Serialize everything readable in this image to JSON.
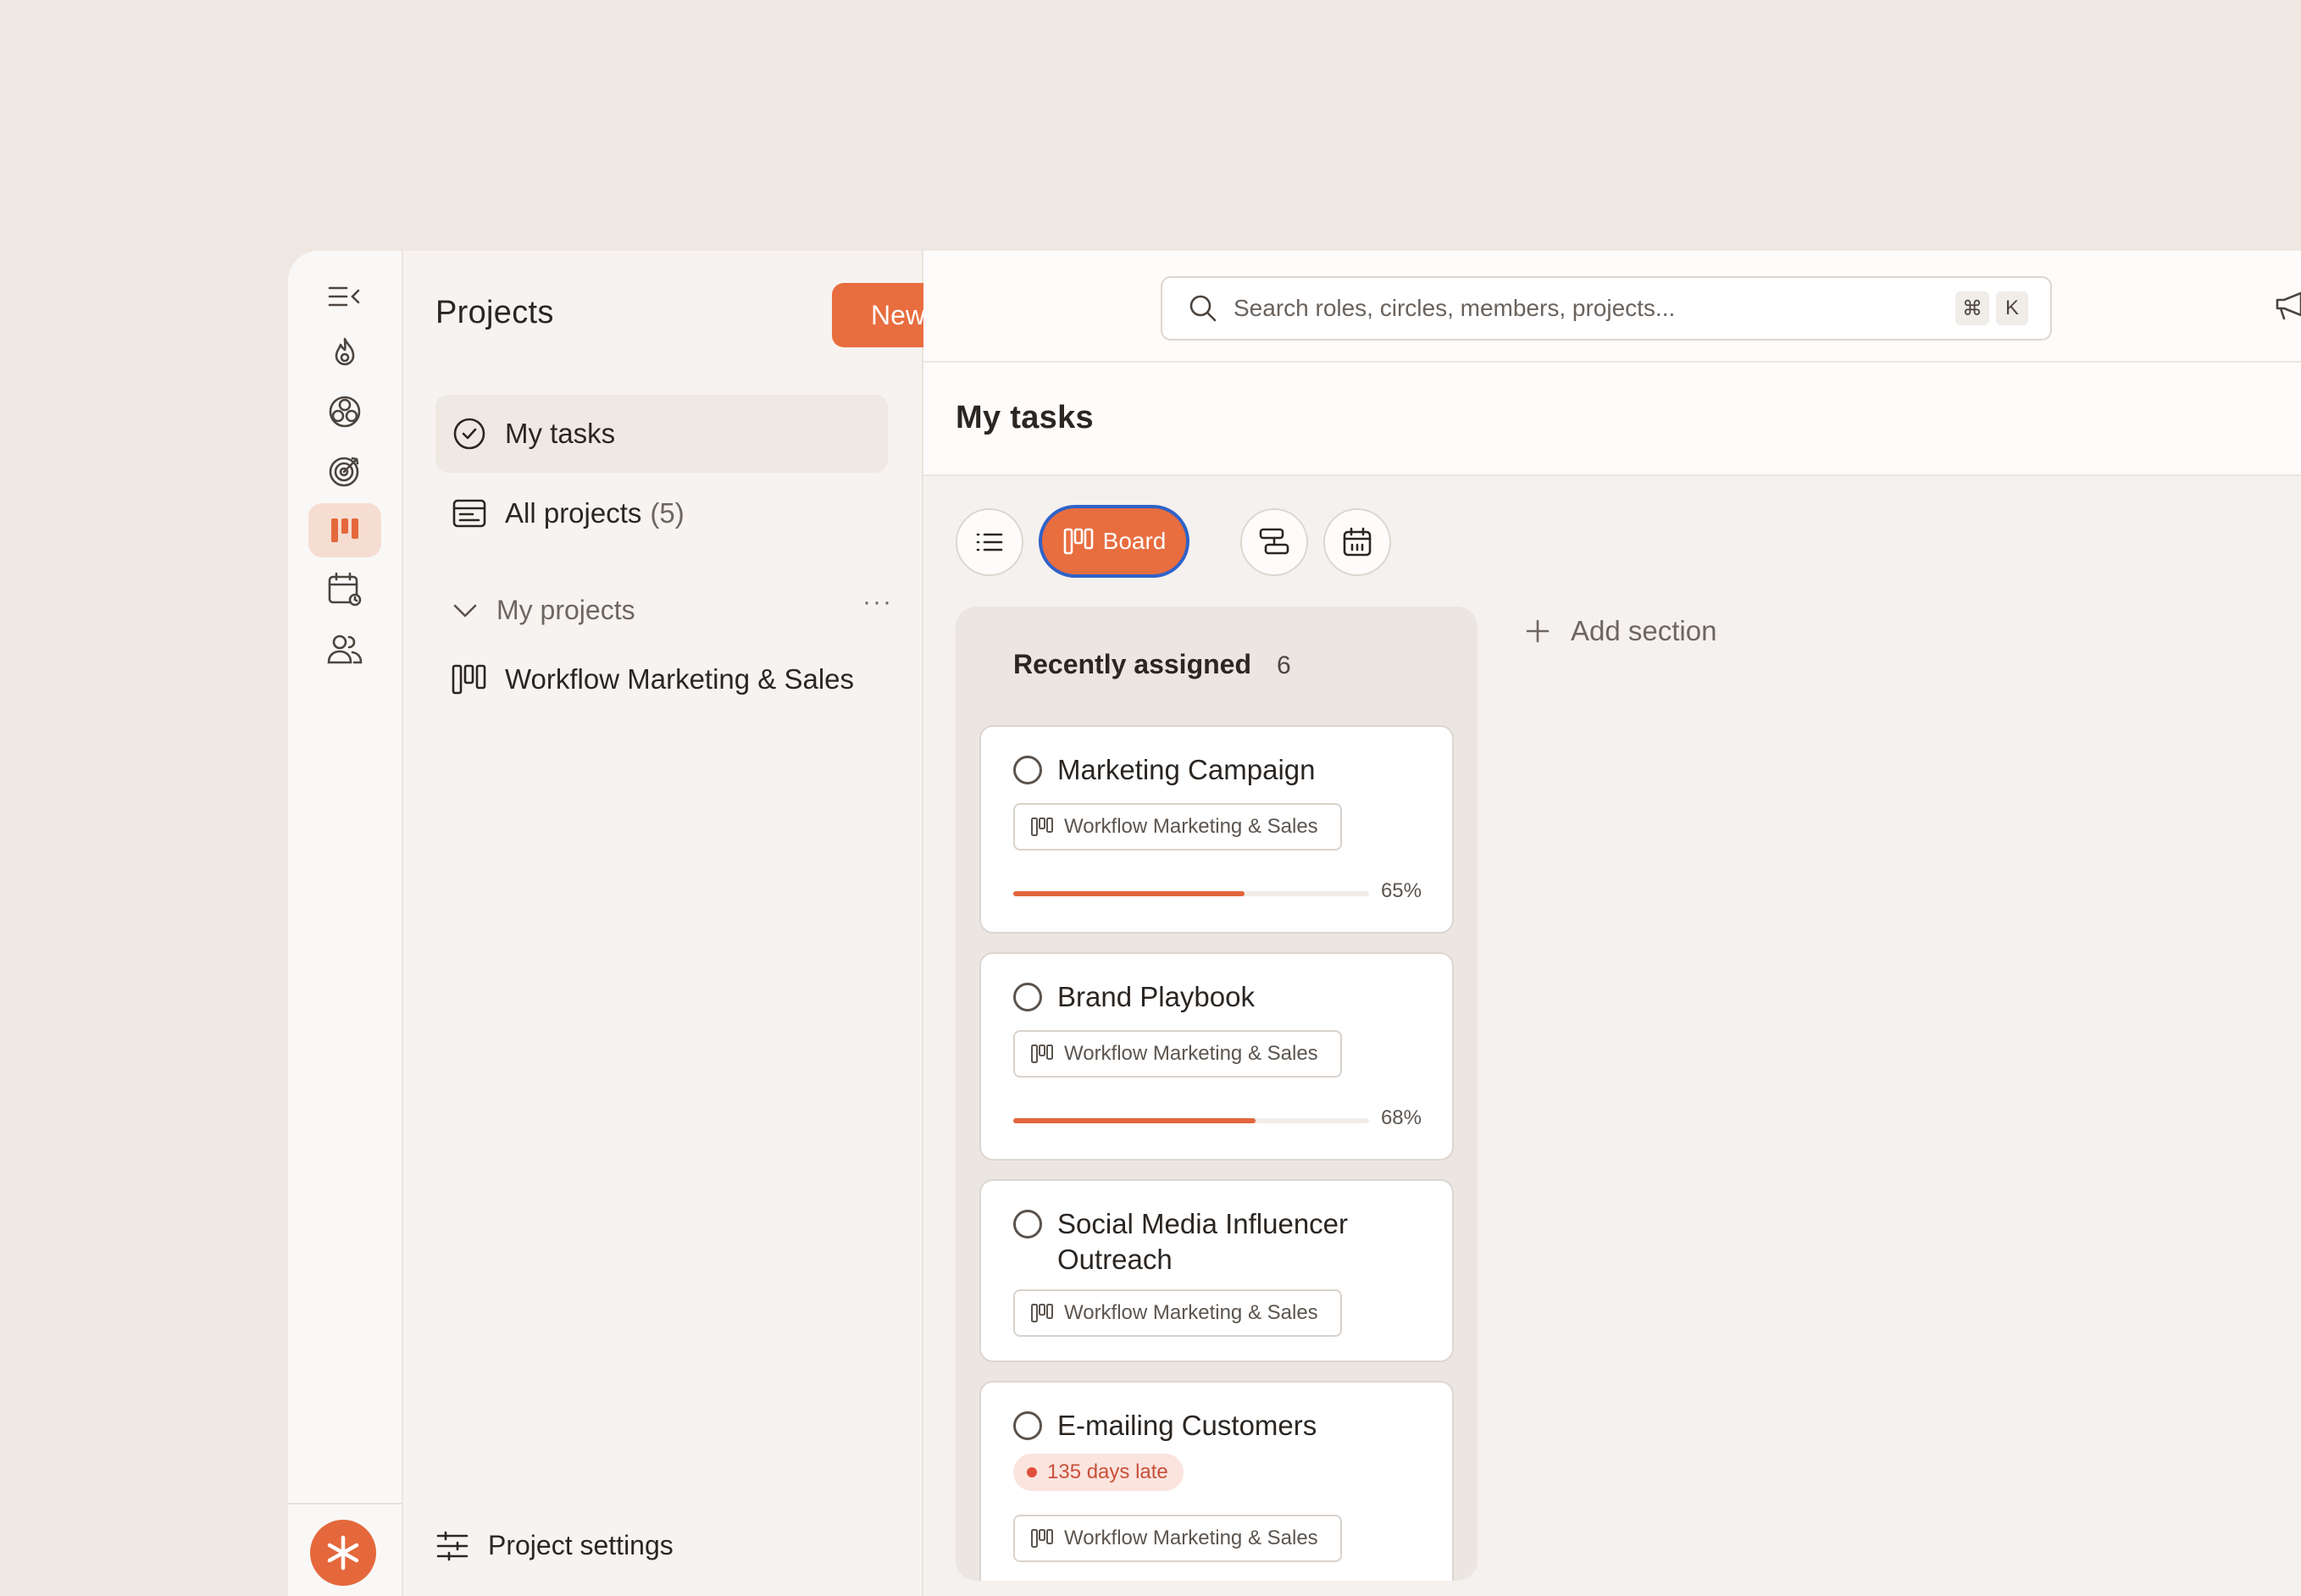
{
  "rail": {
    "items": [
      {
        "icon": "collapse-sidebar-icon"
      },
      {
        "icon": "flame-icon"
      },
      {
        "icon": "circles-icon"
      },
      {
        "icon": "target-icon"
      },
      {
        "icon": "board-icon",
        "active": true
      },
      {
        "icon": "calendar-icon"
      },
      {
        "icon": "people-icon"
      }
    ],
    "logo": "asterisk-logo"
  },
  "panel": {
    "title": "Projects",
    "new_label": "New",
    "nav": [
      {
        "label": "My tasks",
        "icon": "check-circle-icon",
        "active": true
      },
      {
        "label": "All projects",
        "count": "(5)",
        "icon": "projects-icon"
      }
    ],
    "section_label": "My projects",
    "section_menu": "···",
    "projects": [
      {
        "label": "Workflow Marketing & Sales",
        "icon": "board-icon"
      }
    ],
    "settings_label": "Project settings"
  },
  "topbar": {
    "search_placeholder": "Search roles, circles, members, projects...",
    "shortcut_keys": [
      "⌘",
      "K"
    ]
  },
  "main": {
    "title": "My tasks",
    "views": [
      {
        "icon": "list-icon"
      },
      {
        "icon": "board-icon",
        "label": "Board",
        "active": true
      },
      {
        "icon": "timeline-icon"
      },
      {
        "icon": "calendar-icon"
      }
    ],
    "add_section_label": "Add section"
  },
  "board": {
    "column": {
      "title": "Recently assigned",
      "count": "6",
      "cards": [
        {
          "title": "Marketing Campaign",
          "project": "Workflow Marketing & Sales",
          "progress": 65,
          "progress_label": "65%"
        },
        {
          "title": "Brand Playbook",
          "project": "Workflow Marketing & Sales",
          "progress": 68,
          "progress_label": "68%"
        },
        {
          "title": "Social Media Influencer Outreach",
          "project": "Workflow Marketing & Sales"
        },
        {
          "title": "E-mailing Customers",
          "late": "135 days late",
          "project": "Workflow Marketing & Sales"
        }
      ]
    }
  },
  "colors": {
    "accent": "#e86d3f",
    "focus_ring": "#2f62c9",
    "late": "#e0503a"
  }
}
